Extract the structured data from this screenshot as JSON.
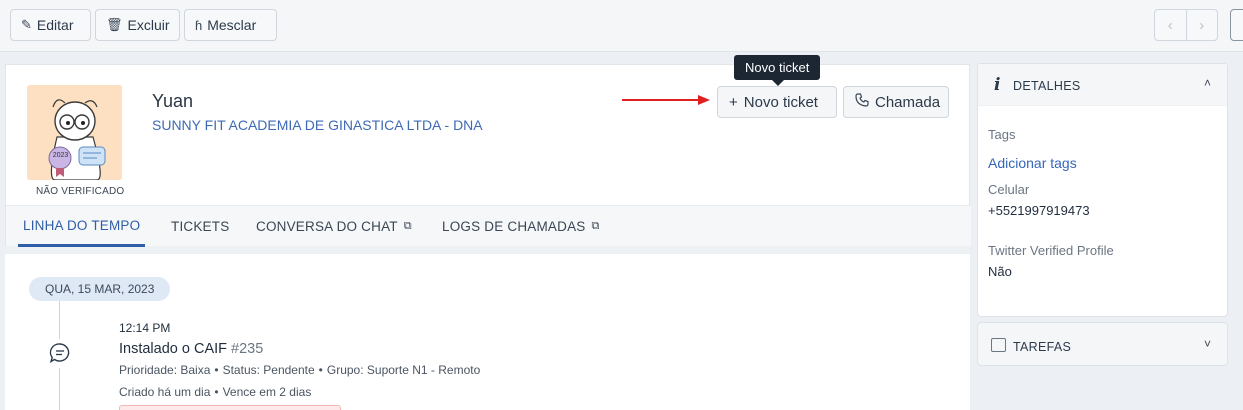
{
  "toolbar": {
    "edit_label": "Editar",
    "delete_label": "Excluir",
    "merge_label": "Mesclar",
    "prev": "‹",
    "next": "›"
  },
  "contact": {
    "name": "Yuan",
    "organization": "SUNNY FIT ACADEMIA DE GINASTICA LTDA - DNA",
    "verification": "NÃO VERIFICADO",
    "avatar_badge": "2023"
  },
  "actions": {
    "tooltip": "Novo ticket",
    "new_ticket": "Novo ticket",
    "new_ticket_icon": "+",
    "call": "Chamada",
    "arrow_color": "#e02020"
  },
  "tabs": [
    {
      "label": "LINHA DO TEMPO",
      "active": true
    },
    {
      "label": "TICKETS"
    },
    {
      "label": "CONVERSA DO CHAT",
      "external": true
    },
    {
      "label": "LOGS DE CHAMADAS",
      "external": true
    }
  ],
  "timeline": {
    "date": "QUA, 15 MAR, 2023",
    "entry": {
      "time": "12:14 PM",
      "title": "Instalado o CAIF",
      "number": "#235",
      "priority": "Prioridade: Baixa",
      "status": "Status: Pendente",
      "group": "Grupo: Suporte N1 - Remoto",
      "created": "Criado há um dia",
      "due": "Vence em 2 dias"
    }
  },
  "details": {
    "title": "DETALHES",
    "tags_label": "Tags",
    "add_tags": "Adicionar tags",
    "phone_label": "Celular",
    "phone_value": "+5521997919473",
    "twitter_label": "Twitter Verified Profile",
    "twitter_value": "Não"
  },
  "tasks": {
    "title": "TAREFAS"
  },
  "colors": {
    "accent": "#2f5ea8",
    "link": "#3566b8"
  }
}
